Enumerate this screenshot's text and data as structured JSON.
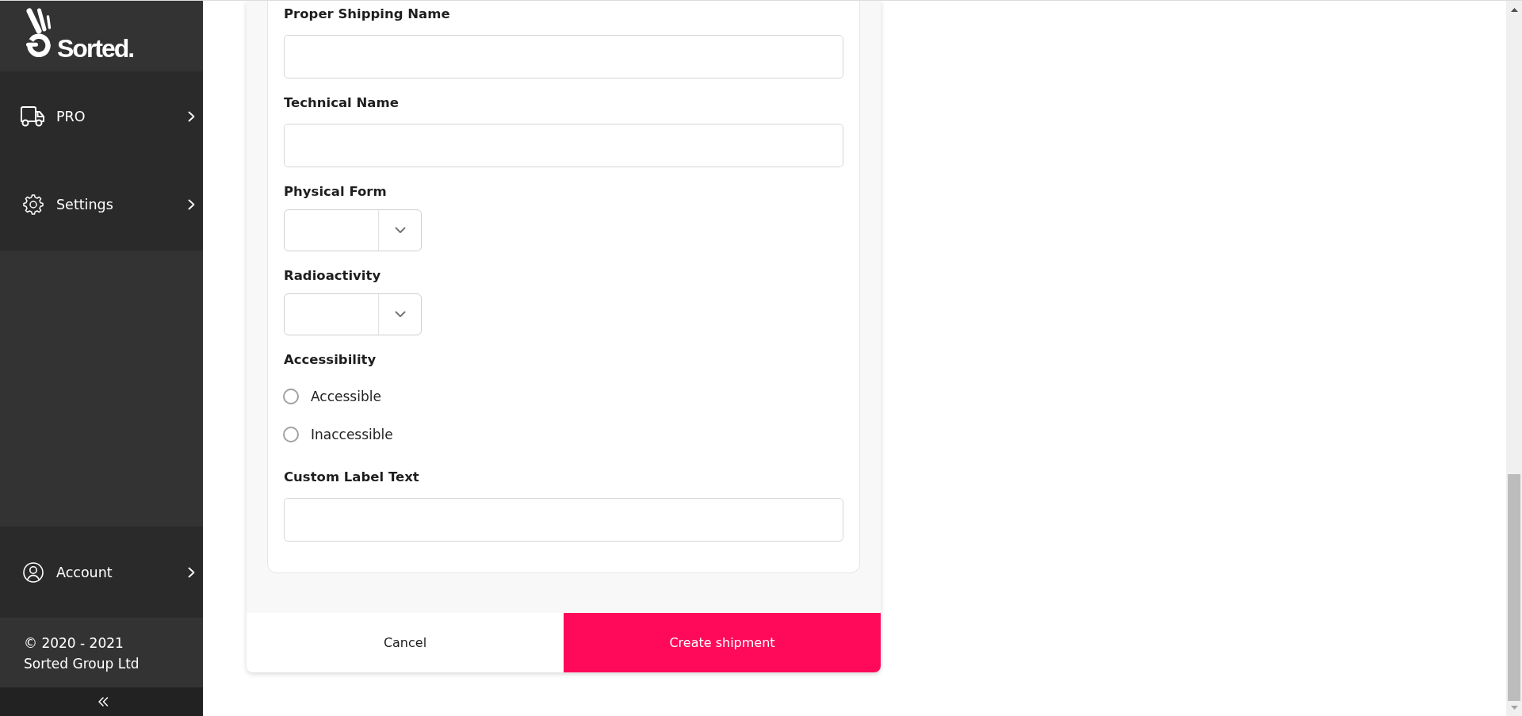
{
  "sidebar": {
    "logo": {
      "text": "Sorted."
    },
    "nav_items": [
      {
        "label": "PRO"
      },
      {
        "label": "Settings"
      }
    ],
    "account": {
      "label": "Account"
    },
    "copyright_lines": [
      "© 2020 - 2021",
      "Sorted Group Ltd"
    ]
  },
  "form": {
    "fields": [
      {
        "kind": "text",
        "label": "Proper Shipping Name"
      },
      {
        "kind": "text",
        "label": "Technical Name"
      },
      {
        "kind": "select",
        "label": "Physical Form"
      },
      {
        "kind": "select",
        "label": "Radioactivity"
      },
      {
        "kind": "radio",
        "label": "Accessibility",
        "options": [
          {
            "label": "Accessible",
            "selected": false
          },
          {
            "label": "Inaccessible",
            "selected": false
          }
        ]
      },
      {
        "kind": "text",
        "label": "Custom Label Text"
      }
    ]
  },
  "footer": {
    "buttons": [
      {
        "kind": "cancel",
        "label": "Cancel"
      },
      {
        "kind": "create",
        "label": "Create shipment"
      }
    ]
  }
}
